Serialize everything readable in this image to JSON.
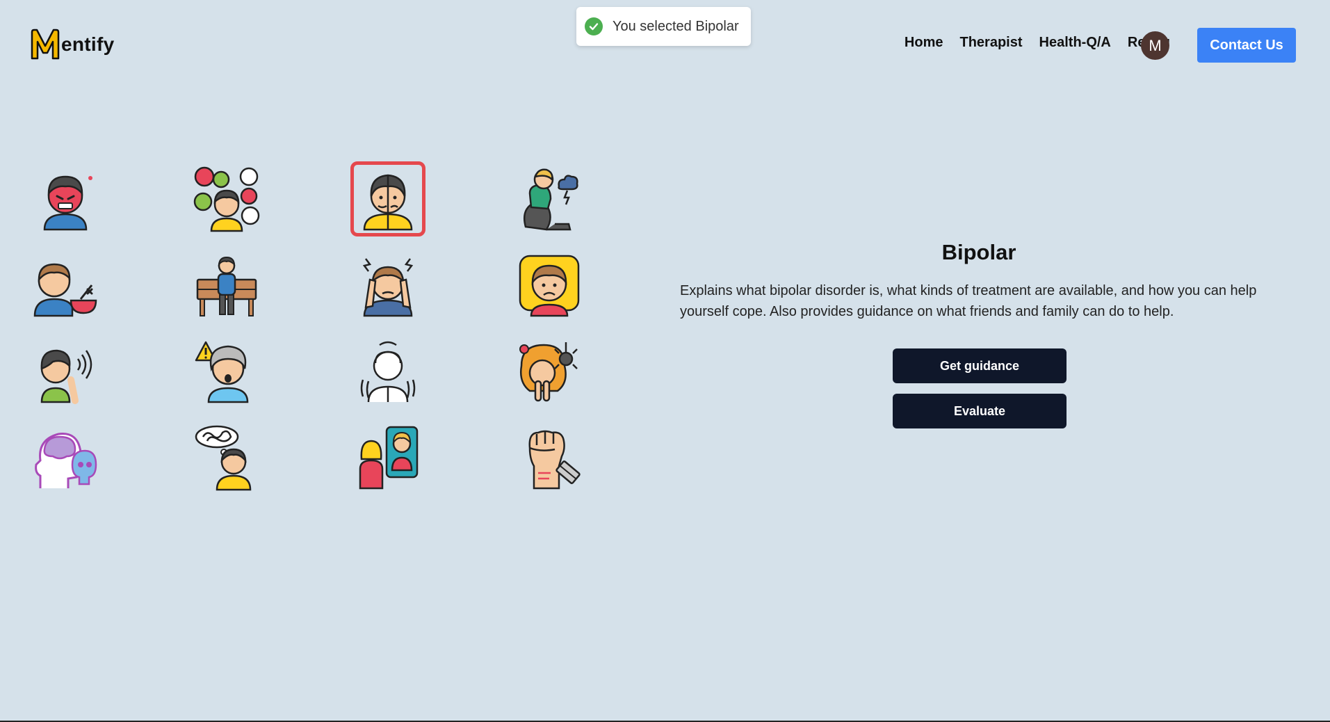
{
  "brand": {
    "name_suffix": "entify",
    "logo_letter": "M",
    "logo_color": "#f5b800"
  },
  "nav": {
    "items": [
      "Home",
      "Therapist",
      "Health-Q/A",
      "Rekog"
    ]
  },
  "avatar": {
    "initial": "M",
    "color": "#4e3530"
  },
  "contact": {
    "label": "Contact Us",
    "color": "#3b82f6"
  },
  "toast": {
    "text": "You selected Bipolar",
    "icon": "check-circle-icon"
  },
  "grid": {
    "selected_index": 2,
    "selected_border_color": "#e5484d",
    "icons": [
      "angry-person-icon",
      "confused-person-icon",
      "bipolar-person-icon",
      "sad-sitting-person-icon",
      "eating-disorder-icon",
      "person-on-bench-icon",
      "stressed-person-icon",
      "person-in-pillow-icon",
      "hearing-voices-icon",
      "anxious-person-icon",
      "trembling-person-icon",
      "phobia-person-icon",
      "brain-skull-icon",
      "overthinking-person-icon",
      "mirror-reflection-icon",
      "fist-razor-icon"
    ]
  },
  "detail": {
    "title": "Bipolar",
    "description": "Explains what bipolar disorder is, what kinds of treatment are available, and how you can help yourself cope. Also provides guidance on what friends and family can do to help.",
    "primary_label": "Get guidance",
    "secondary_label": "Evaluate"
  }
}
